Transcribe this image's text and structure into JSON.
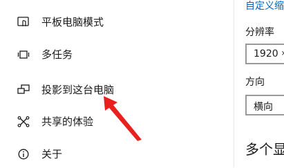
{
  "sidebar": {
    "items": [
      {
        "label": "平板电脑模式",
        "icon": "tablet-mode-icon"
      },
      {
        "label": "多任务",
        "icon": "multitasking-icon"
      },
      {
        "label": "投影到这台电脑",
        "icon": "project-to-pc-icon"
      },
      {
        "label": "共享的体验",
        "icon": "shared-experiences-icon"
      },
      {
        "label": "关于",
        "icon": "info-icon"
      }
    ]
  },
  "main": {
    "custom_link": "自定义缩",
    "resolution_label": "分辨率",
    "resolution_value": "1920",
    "orientation_label": "方向",
    "orientation_value": "横向",
    "section_heading": "多个显"
  },
  "colors": {
    "accent": "#0067c0",
    "annotation_arrow": "#e8211f"
  }
}
